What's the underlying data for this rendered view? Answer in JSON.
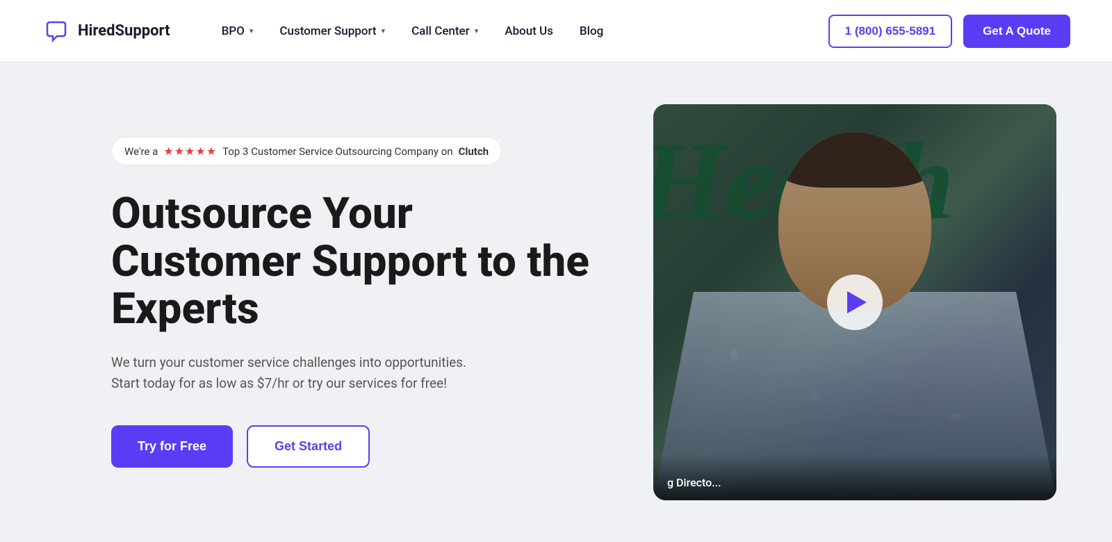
{
  "brand": {
    "name": "HiredSupport",
    "logo_alt": "HiredSupport logo"
  },
  "nav": {
    "items": [
      {
        "label": "BPO",
        "has_dropdown": true
      },
      {
        "label": "Customer Support",
        "has_dropdown": true
      },
      {
        "label": "Call Center",
        "has_dropdown": true
      },
      {
        "label": "About Us",
        "has_dropdown": false
      },
      {
        "label": "Blog",
        "has_dropdown": false
      }
    ],
    "phone": "1 (800) 655-5891",
    "get_quote": "Get A Quote"
  },
  "hero": {
    "badge_text": "We're a",
    "badge_stars": "★★★★★",
    "badge_suffix": "Top 3 Customer Service Outsourcing Company on",
    "badge_bold": "Clutch",
    "title": "Outsource Your Customer Support to the Experts",
    "subtitle": "We turn your customer service challenges into opportunities. Start today for as low as $7/hr or try our services for free!",
    "cta_primary": "Try for Free",
    "cta_secondary": "Get Started"
  },
  "video": {
    "caption": "g Directo...",
    "play_label": "Play video"
  },
  "colors": {
    "brand_purple": "#5b3cf5",
    "dark_text": "#1a1a1a",
    "body_text": "#555555",
    "star_red": "#e53e3e"
  }
}
